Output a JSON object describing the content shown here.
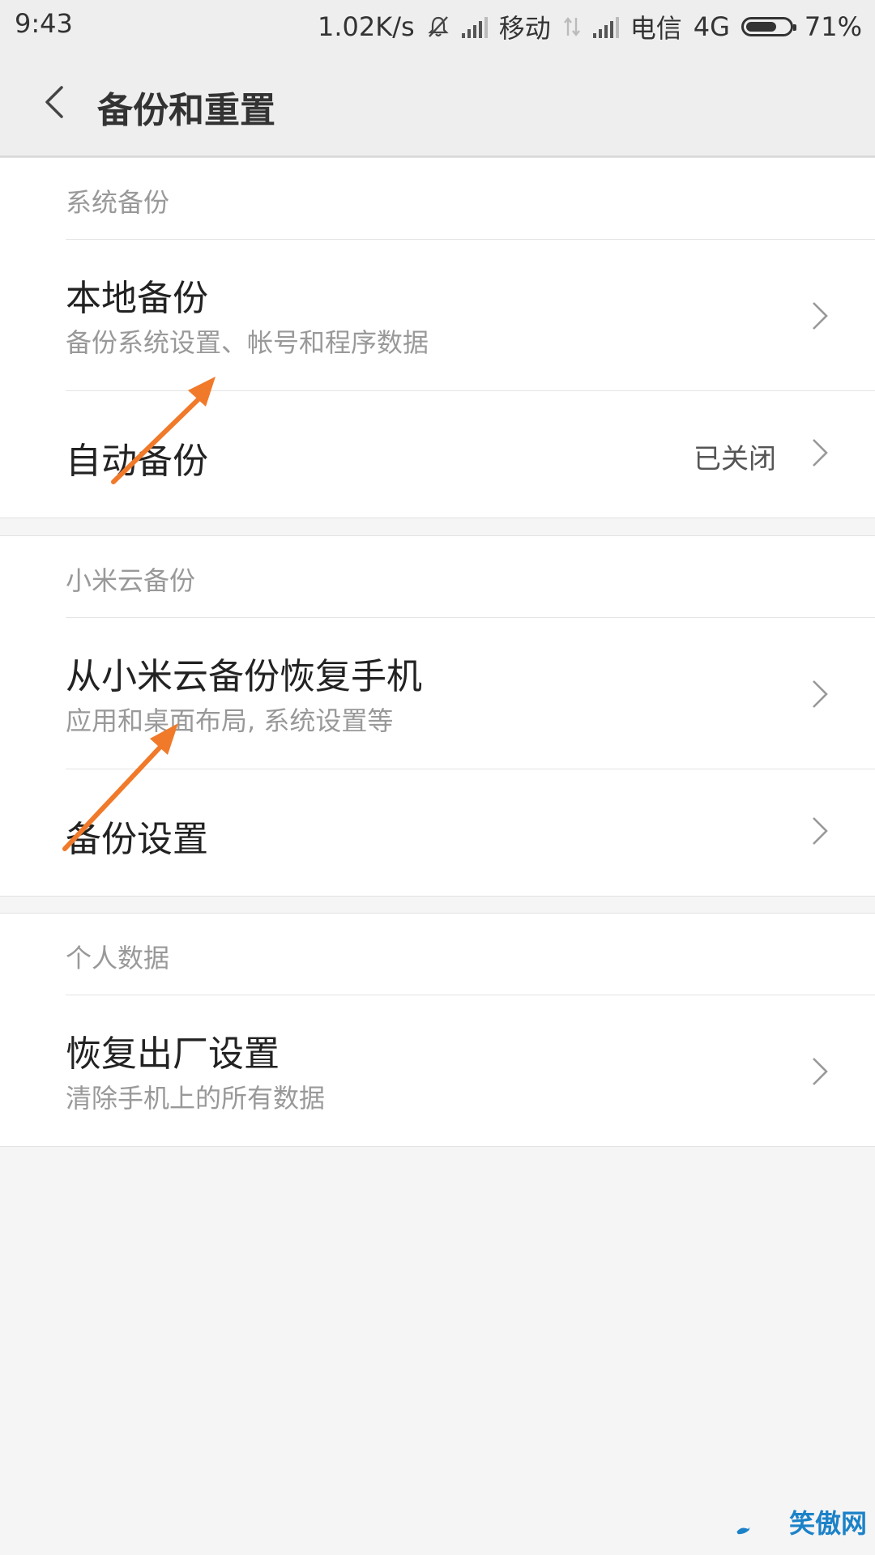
{
  "status_bar": {
    "time": "9:43",
    "speed": "1.02K/s",
    "carrier1": "移动",
    "carrier2": "电信",
    "network": "4G",
    "battery": "71%",
    "battery_level": 0.71
  },
  "header": {
    "title": "备份和重置",
    "back_icon": "chevron-left-icon"
  },
  "sections": [
    {
      "title": "系统备份",
      "items": [
        {
          "title": "本地备份",
          "subtitle": "备份系统设置、帐号和程序数据"
        },
        {
          "title": "自动备份",
          "value": "已关闭"
        }
      ]
    },
    {
      "title": "小米云备份",
      "items": [
        {
          "title": "从小米云备份恢复手机",
          "subtitle": "应用和桌面布局, 系统设置等"
        },
        {
          "title": "备份设置"
        }
      ]
    },
    {
      "title": "个人数据",
      "items": [
        {
          "title": "恢复出厂设置",
          "subtitle": "清除手机上的所有数据"
        }
      ]
    }
  ],
  "colors": {
    "arrow": "#f07a2a",
    "background": "#f5f5f5"
  },
  "watermark": {
    "text": "笑傲网"
  }
}
